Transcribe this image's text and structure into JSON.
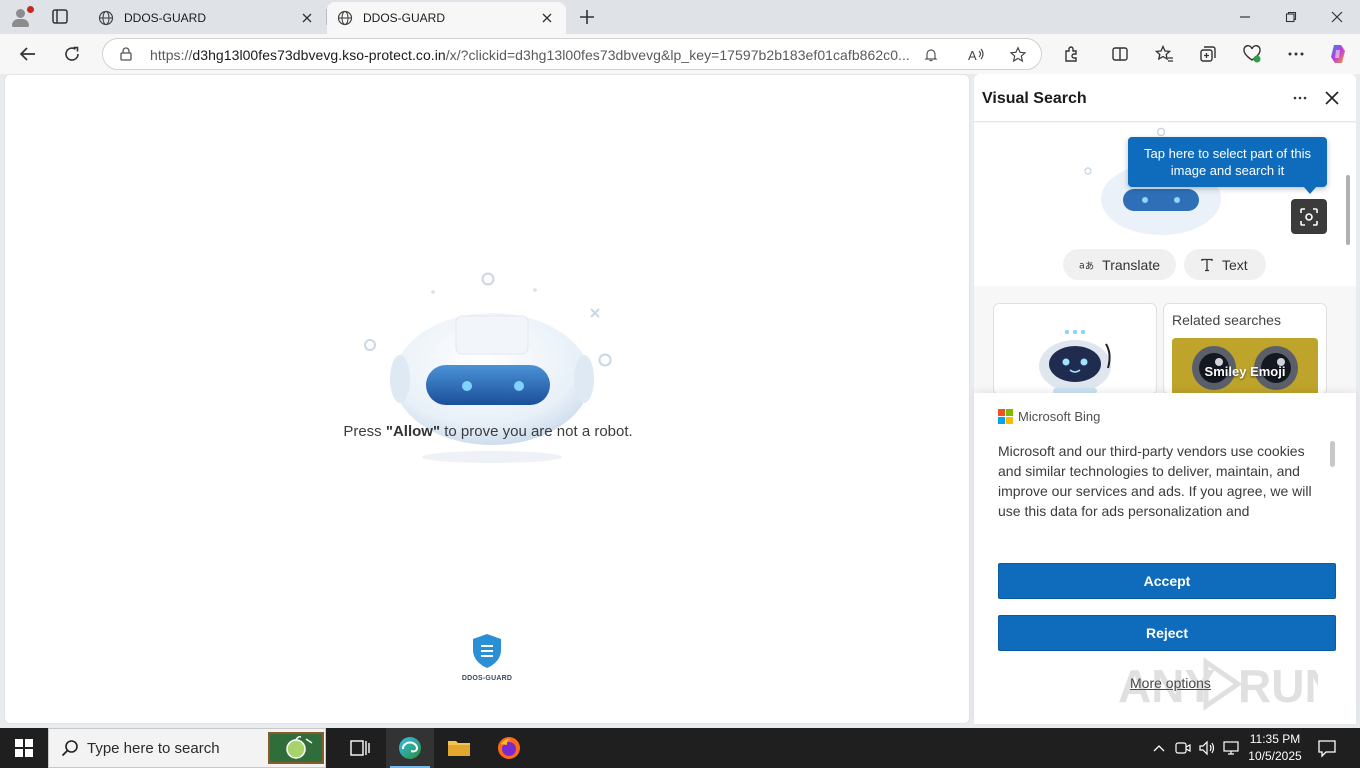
{
  "browser": {
    "tabs": [
      {
        "title": "DDOS-GUARD",
        "active": false
      },
      {
        "title": "DDOS-GUARD",
        "active": true
      }
    ],
    "url_prefix": "https://",
    "url_host": "d3hg13l00fes73dbvevg.kso-protect.co.in",
    "url_rest": "/x/?clickid=d3hg13l00fes73dbvevg&lp_key=17597b2b183ef01cafb862c0..."
  },
  "page": {
    "prompt_before": "Press ",
    "prompt_bold": "\"Allow\"",
    "prompt_after": " to prove you are not a robot.",
    "logo_text": "DDOS-GUARD"
  },
  "visual_search": {
    "title": "Visual Search",
    "tooltip": "Tap here to select part of this image and search it",
    "chips": {
      "translate": "Translate",
      "text": "Text"
    },
    "related_title": "Related searches",
    "related_items": [
      "Smiley Emoji"
    ]
  },
  "consent": {
    "brand": "Microsoft Bing",
    "text": "Microsoft and our third-party vendors use cookies and similar technologies to deliver, maintain, and improve our services and ads. If you agree, we will use this data for ads personalization and",
    "accept": "Accept",
    "reject": "Reject",
    "more": "More options"
  },
  "taskbar": {
    "search_placeholder": "Type here to search",
    "time": "11:35 PM",
    "date": "10/5/2025"
  },
  "colors": {
    "accent_blue": "#0f6cbd",
    "ms_red": "#f25022",
    "ms_green": "#7fba00",
    "ms_blue": "#00a4ef",
    "ms_yellow": "#ffb900"
  }
}
